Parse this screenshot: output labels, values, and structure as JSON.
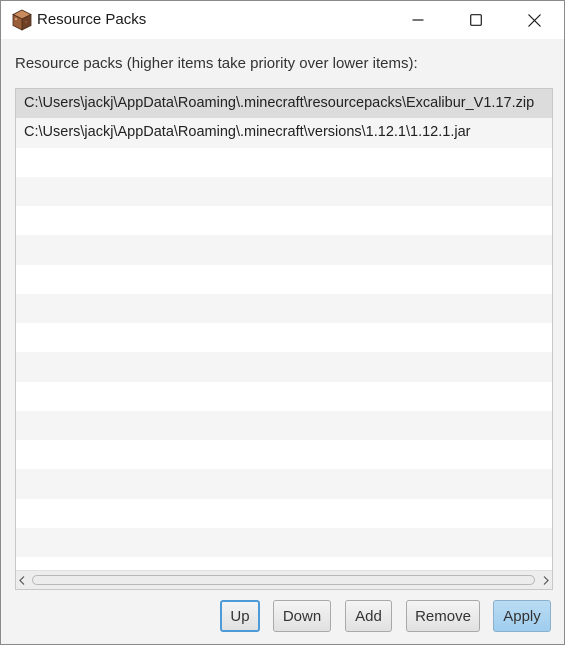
{
  "window": {
    "title": "Resource Packs"
  },
  "icons": {
    "app": "cube-icon",
    "minimize": "minimize-icon",
    "maximize": "maximize-icon",
    "close": "close-icon",
    "scroll_left": "chevron-left-icon",
    "scroll_right": "chevron-right-icon"
  },
  "caption": "Resource packs (higher items take priority over lower items):",
  "packs": [
    "C:\\Users\\jackj\\AppData\\Roaming\\.minecraft\\resourcepacks\\Excalibur_V1.17.zip",
    "C:\\Users\\jackj\\AppData\\Roaming\\.minecraft\\versions\\1.12.1\\1.12.1.jar"
  ],
  "selected_index": 0,
  "buttons": {
    "up": "Up",
    "down": "Down",
    "add": "Add",
    "remove": "Remove",
    "apply": "Apply"
  },
  "colors": {
    "selected_row": "#dcdcdc",
    "apply_button": "#a8d2f0",
    "focus_ring": "#4a9bd8"
  }
}
